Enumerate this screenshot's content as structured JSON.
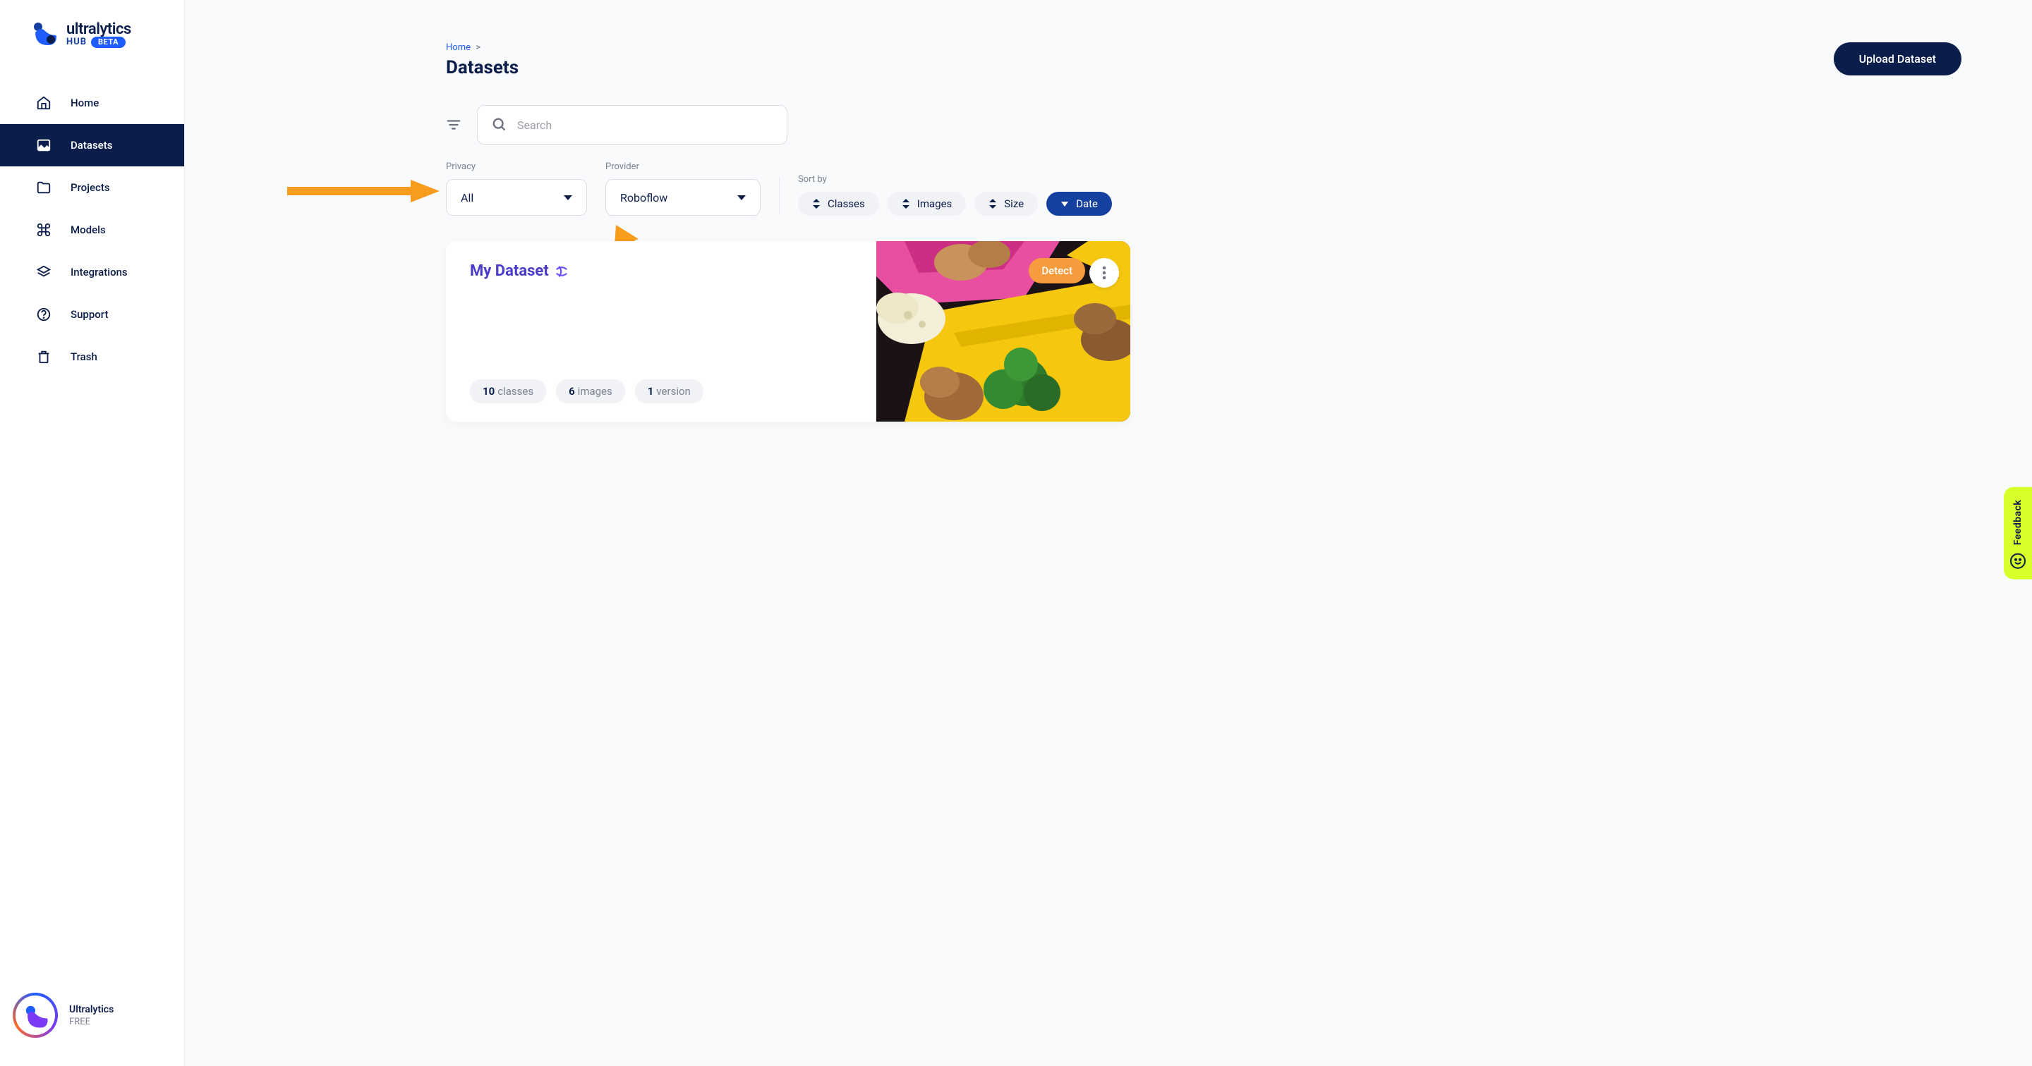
{
  "brand": {
    "name": "ultralytics",
    "hub": "HUB",
    "beta": "BETA"
  },
  "sidebar": {
    "items": [
      {
        "label": "Home",
        "icon": "home"
      },
      {
        "label": "Datasets",
        "icon": "image",
        "active": true
      },
      {
        "label": "Projects",
        "icon": "folder"
      },
      {
        "label": "Models",
        "icon": "command"
      },
      {
        "label": "Integrations",
        "icon": "layers"
      },
      {
        "label": "Support",
        "icon": "help"
      },
      {
        "label": "Trash",
        "icon": "trash"
      }
    ],
    "user": {
      "name": "Ultralytics",
      "plan": "FREE"
    }
  },
  "breadcrumb": {
    "home": "Home",
    "sep": ">"
  },
  "page": {
    "title": "Datasets"
  },
  "actions": {
    "upload": "Upload Dataset"
  },
  "search": {
    "placeholder": "Search",
    "value": ""
  },
  "filters": {
    "privacy": {
      "label": "Privacy",
      "value": "All"
    },
    "provider": {
      "label": "Provider",
      "value": "Roboflow"
    }
  },
  "sort": {
    "label": "Sort by",
    "options": [
      {
        "label": "Classes"
      },
      {
        "label": "Images"
      },
      {
        "label": "Size"
      },
      {
        "label": "Date",
        "active": true
      }
    ]
  },
  "dataset": {
    "name": "My Dataset",
    "badge": "Detect",
    "classes_count": 10,
    "classes_label": "classes",
    "images_count": 6,
    "images_label": "images",
    "versions_count": 1,
    "versions_label": "version"
  },
  "feedback": {
    "label": "Feedback"
  }
}
